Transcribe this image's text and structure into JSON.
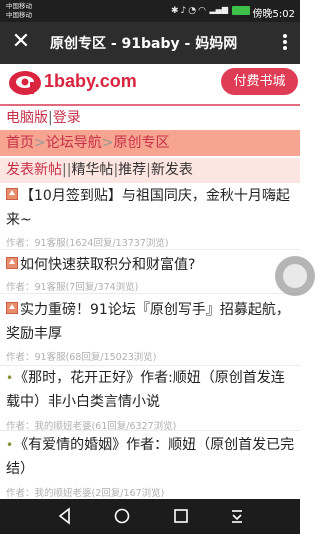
{
  "status_bar": {
    "carrier_1": "中国移动",
    "carrier_2": "中国移动",
    "time": "傍晚5:02",
    "battery_color": "#3ec14a"
  },
  "titlebar": {
    "title": "原创专区 - 91baby - 妈妈网"
  },
  "header": {
    "logo_text": "1baby.com",
    "shop_button": "付费书城"
  },
  "account_links": {
    "desktop": "电脑版",
    "separator": "|",
    "login": "登录"
  },
  "breadcrumb": {
    "home": "首页",
    "forum_nav": "论坛导航",
    "current": "原创专区",
    "separator": ">"
  },
  "tabs": {
    "publish": "发表新帖",
    "sep1": "|",
    "sep2": "|",
    "sep3": "|",
    "featured": "精华帖",
    "recommend": "推荐",
    "sep4": "|",
    "newest": "新发表"
  },
  "posts": [
    {
      "marker": "arrow",
      "title": "【10月签到贴】与祖国同庆，金秋十月嗨起来~",
      "meta": "作者：91客服(1624回复/13737浏览)"
    },
    {
      "marker": "arrow",
      "title": "如何快速获取积分和财富值?",
      "meta": "作者：91客服(7回复/374浏览)"
    },
    {
      "marker": "arrow",
      "title": "实力重磅！91论坛『原创写手』招募起航，奖励丰厚",
      "meta": "作者：91客服(68回复/15023浏览)"
    },
    {
      "marker": "dot",
      "title": "《那时，花开正好》作者:顺妞（原创首发连载中）非小白类言情小说",
      "meta": "作者：我的顺妞老婆(61回复/6327浏览)"
    },
    {
      "marker": "dot",
      "title": "《有爱情的婚姻》作者：顺妞（原创首发已完结）",
      "meta": "作者：我的顺妞老婆(2回复/167浏览)"
    }
  ],
  "colors": {
    "brand_red": "#c63048",
    "button_red": "#df3c55",
    "breadcrumb_bg": "#f7a491",
    "tabs_bg": "#fde6e1"
  }
}
